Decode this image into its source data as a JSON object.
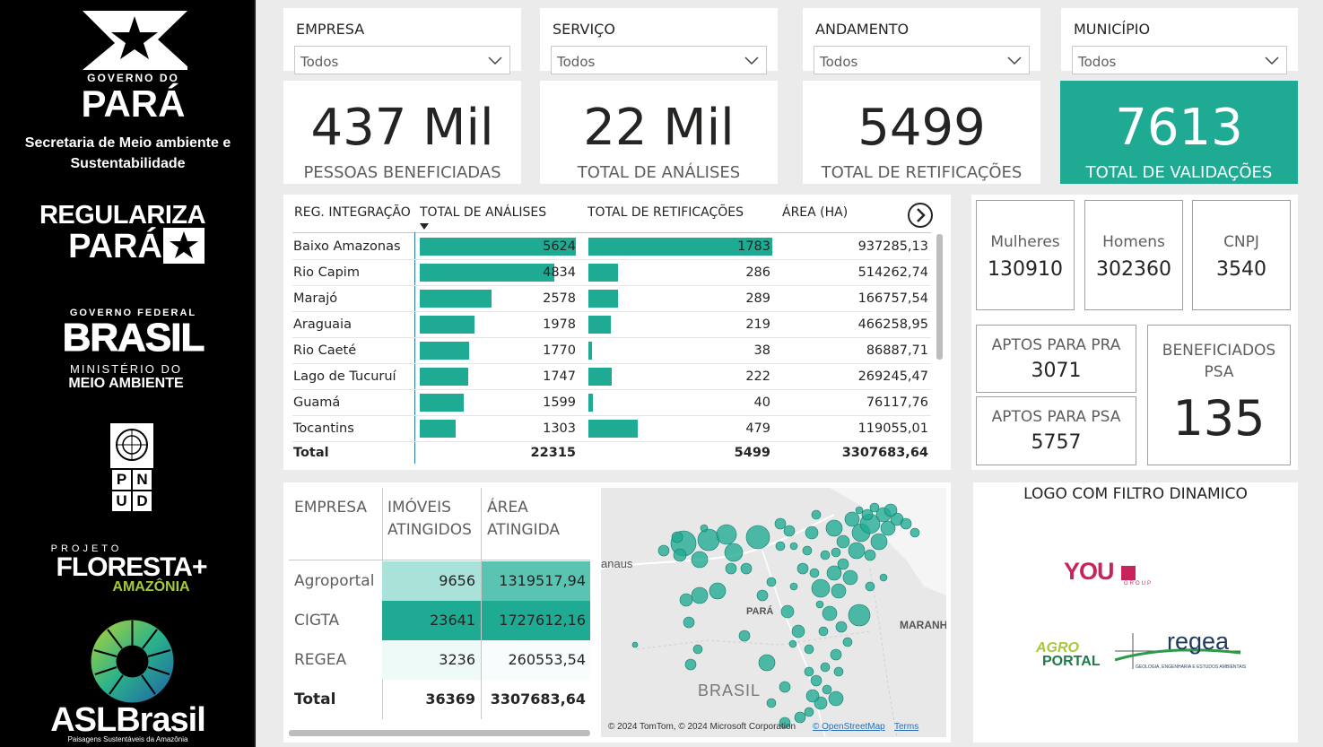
{
  "sidebar": {
    "gov_do": "GOVERNO DO",
    "para": "PARÁ",
    "secretaria": "Secretaria de Meio ambiente e Sustentabilidade",
    "regulariza_1": "REGULARIZA",
    "regulariza_2": "PARÁ",
    "governo_federal": "GOVERNO FEDERAL",
    "brasil": "BRASIL",
    "ministerio_do": "MINISTÉRIO DO",
    "meio_ambiente": "MEIO AMBIENTE",
    "pnud_letters": [
      "P",
      "N",
      "U",
      "D"
    ],
    "projeto": "PROJETO",
    "floresta": "FLORESTA+",
    "amazonia": "AMAZÔNIA",
    "asl": "ASLBrasil",
    "asl_sub": "Paisagens Sustentáveis da Amazônia"
  },
  "slicers": [
    {
      "title": "EMPRESA",
      "value": "Todos"
    },
    {
      "title": "SERVIÇO",
      "value": "Todos"
    },
    {
      "title": "ANDAMENTO",
      "value": "Todos"
    },
    {
      "title": "MUNICÍPIO",
      "value": "Todos"
    }
  ],
  "kpis": [
    {
      "value": "437 Mil",
      "label": "PESSOAS BENEFICIADAS"
    },
    {
      "value": "22 Mil",
      "label": "TOTAL DE ANÁLISES"
    },
    {
      "value": "5499",
      "label": "TOTAL DE RETIFICAÇÕES"
    },
    {
      "value": "7613",
      "label": "TOTAL DE VALIDAÇÕES"
    }
  ],
  "region_table": {
    "headers": [
      "REG. INTEGRAÇÃO",
      "TOTAL DE ANÁLISES",
      "TOTAL DE RETIFICAÇÕES",
      "ÁREA (HA)"
    ],
    "rows": [
      {
        "name": "Baixo Amazonas",
        "analises": 5624,
        "retif": 1783,
        "area": "937285,13"
      },
      {
        "name": "Rio Capim",
        "analises": 4834,
        "retif": 286,
        "area": "514262,74"
      },
      {
        "name": "Marajó",
        "analises": 2578,
        "retif": 289,
        "area": "166757,54"
      },
      {
        "name": "Araguaia",
        "analises": 1978,
        "retif": 219,
        "area": "466258,95"
      },
      {
        "name": "Rio Caeté",
        "analises": 1770,
        "retif": 38,
        "area": "86887,71"
      },
      {
        "name": "Lago de Tucuruí",
        "analises": 1747,
        "retif": 222,
        "area": "269245,47"
      },
      {
        "name": "Guamá",
        "analises": 1599,
        "retif": 40,
        "area": "76117,76"
      },
      {
        "name": "Tocantins",
        "analises": 1303,
        "retif": 479,
        "area": "119055,01"
      }
    ],
    "total": {
      "label": "Total",
      "analises": "22315",
      "retif": "5499",
      "area": "3307683,64"
    },
    "accent_color": "#1fab93"
  },
  "stats": {
    "mulheres": {
      "label": "Mulheres",
      "value": "130910"
    },
    "homens": {
      "label": "Homens",
      "value": "302360"
    },
    "cnpj": {
      "label": "CNPJ",
      "value": "3540"
    },
    "aptos_pra": {
      "label": "APTOS PARA PRA",
      "value": "3071"
    },
    "aptos_psa": {
      "label": "APTOS PARA PSA",
      "value": "5757"
    },
    "benef_psa": {
      "label_1": "BENEFICIADOS",
      "label_2": "PSA",
      "value": "135"
    }
  },
  "empresa_table": {
    "headers": {
      "empresa": "EMPRESA",
      "imoveis_1": "IMÓVEIS",
      "imoveis_2": "ATINGIDOS",
      "area_1": "ÁREA",
      "area_2": "ATINGIDA"
    },
    "rows": [
      {
        "name": "Agroportal",
        "imoveis": "9656",
        "area": "1319517,94"
      },
      {
        "name": "CIGTA",
        "imoveis": "23641",
        "area": "1727612,16"
      },
      {
        "name": "REGEA",
        "imoveis": "3236",
        "area": "260553,54"
      }
    ],
    "total": {
      "label": "Total",
      "imoveis": "36369",
      "area": "3307683,64"
    }
  },
  "map": {
    "labels": {
      "manaus": "anaus",
      "para": "PARÁ",
      "maranhao": "MARANH",
      "brasil": "BRASIL"
    },
    "attribution": "© 2024 TomTom, © 2024 Microsoft Corporation",
    "osm": "© OpenStreetMap",
    "terms": "Terms",
    "bubble_color": "#1fab93"
  },
  "logos": {
    "title": "LOGO COM FILTRO DINAMICO",
    "you": "YOU",
    "you_group": "GROUP",
    "agro": "AGRO",
    "portal": "PORTAL",
    "regea": "regea",
    "regea_sub": "GEOLOGIA, ENGENHARIA E ESTUDOS AMBIENTAIS"
  }
}
